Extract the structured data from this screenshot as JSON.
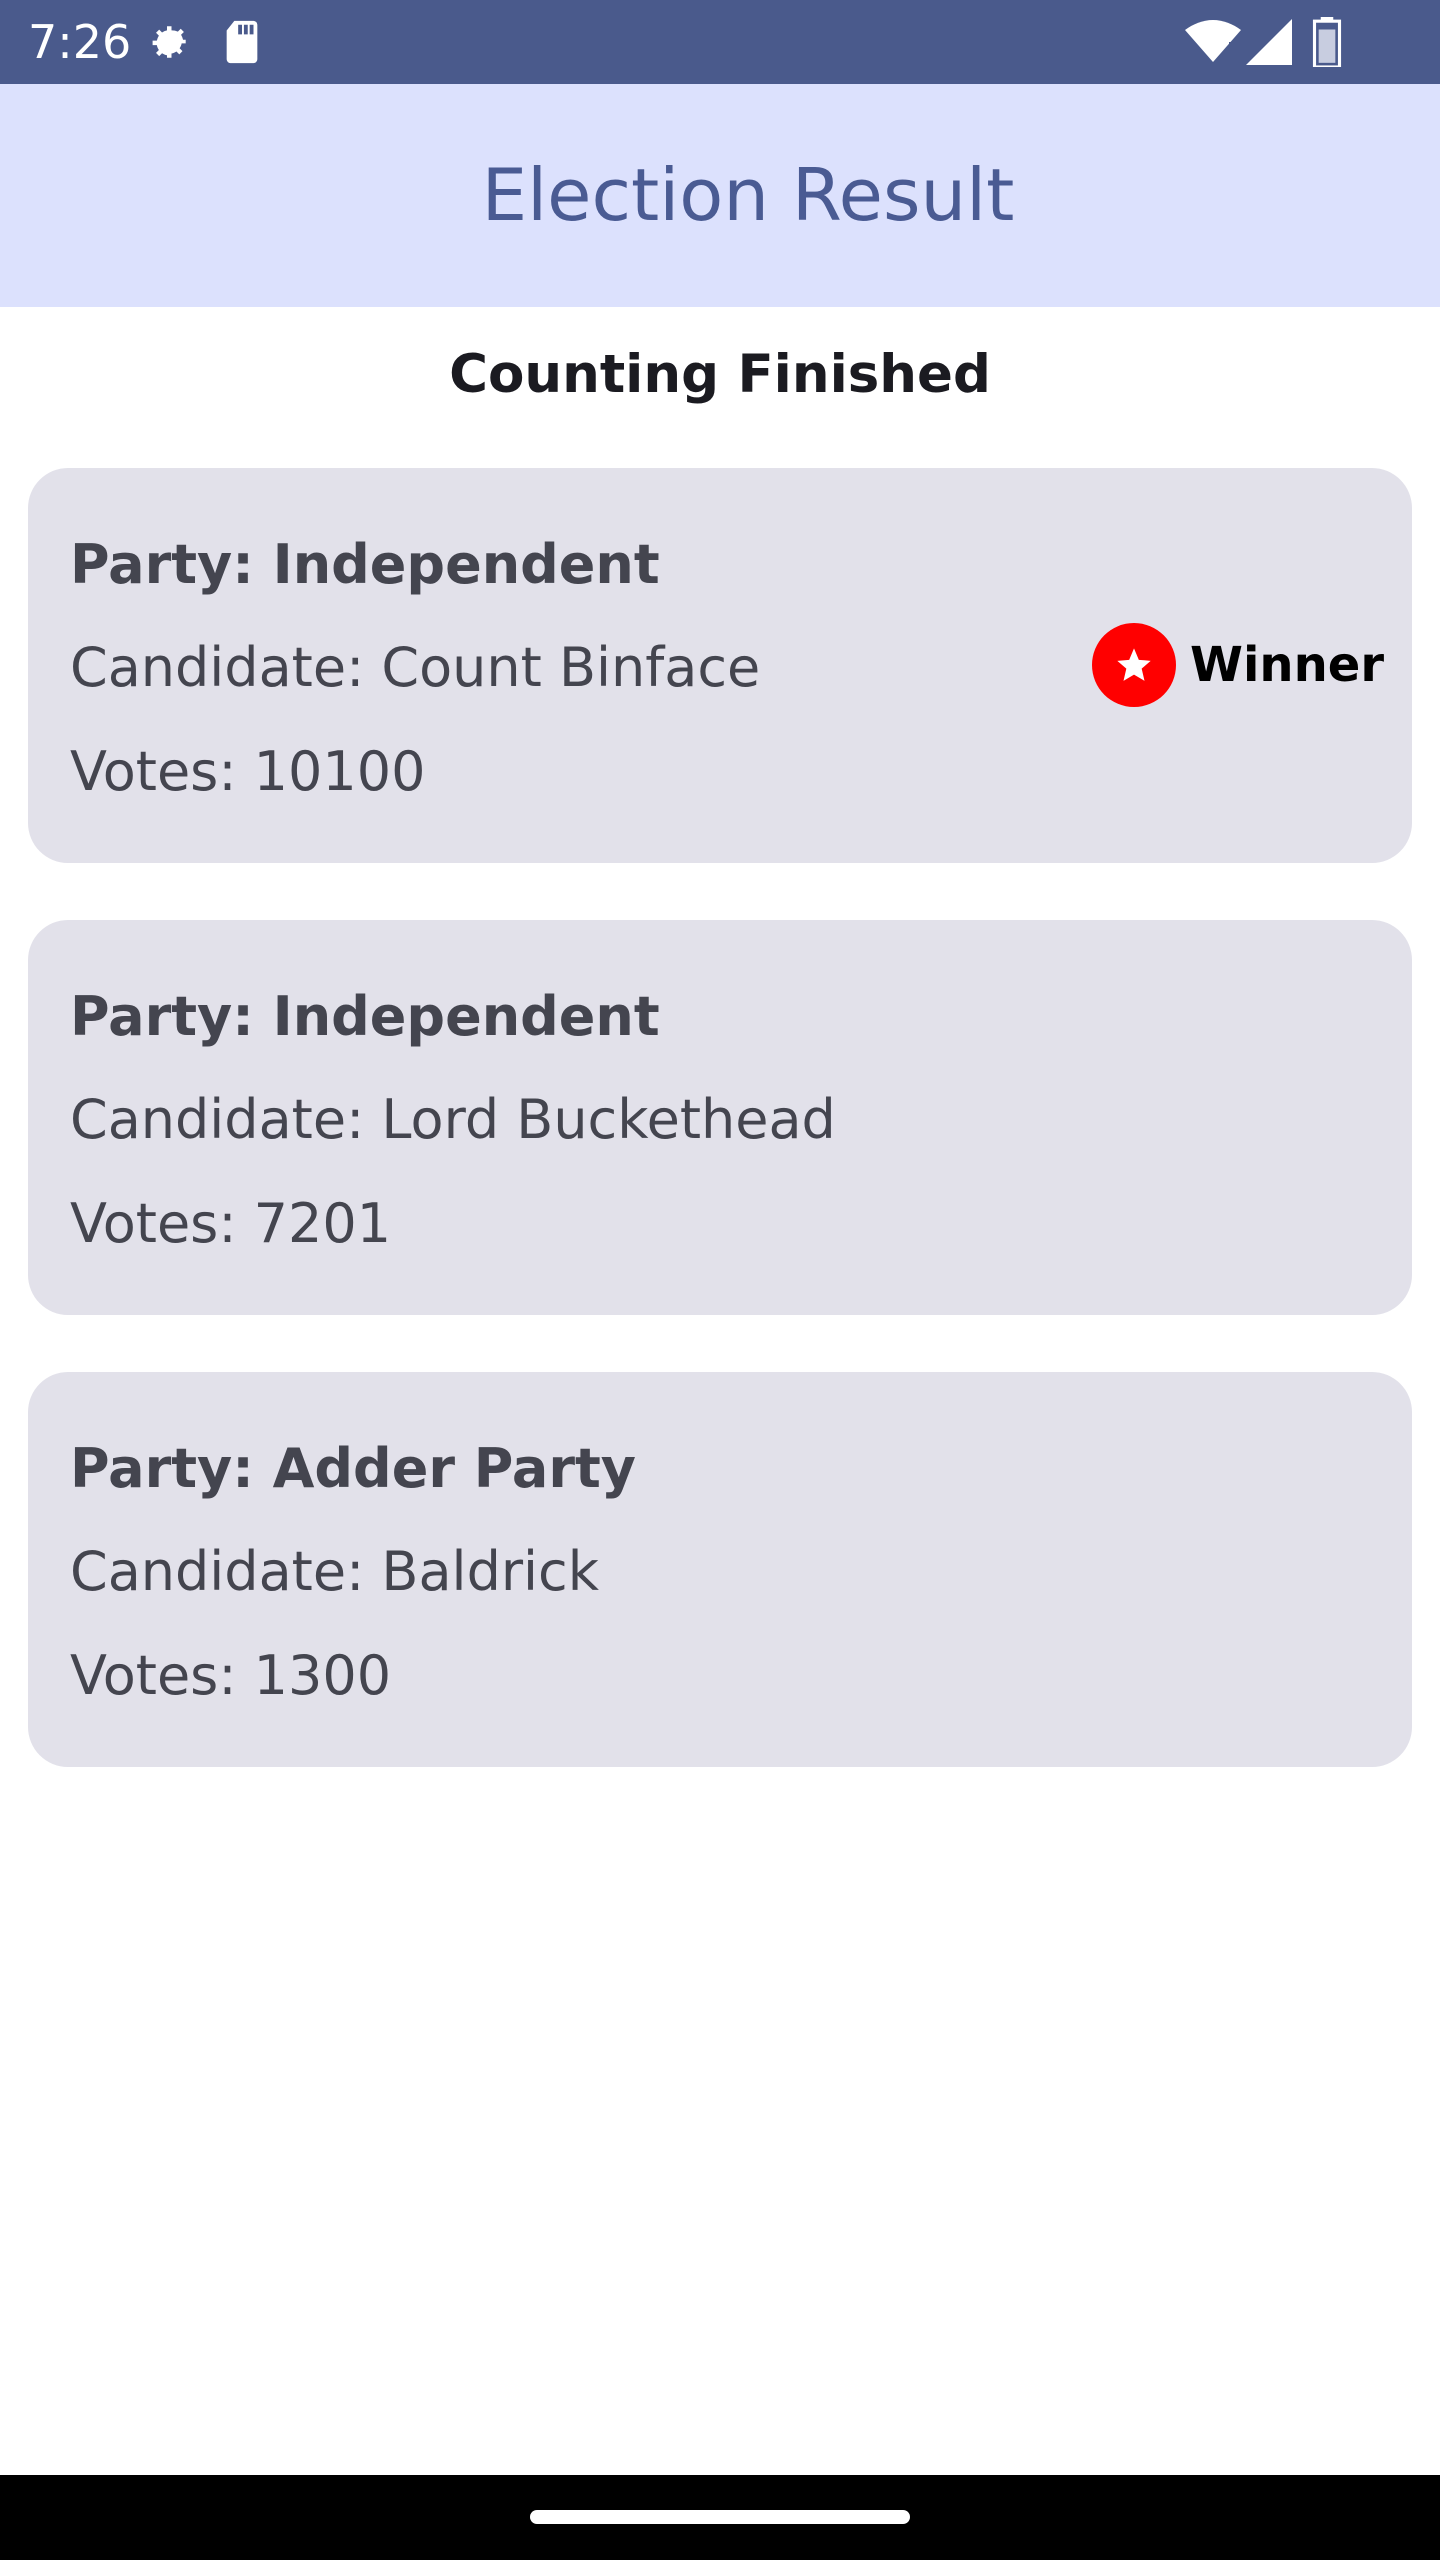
{
  "status_bar": {
    "time": "7:26",
    "icons": [
      "settings-gear-icon",
      "sd-card-icon",
      "wifi-icon",
      "cell-signal-icon",
      "battery-icon"
    ]
  },
  "app_bar": {
    "title": "Election Result"
  },
  "counting_status": "Counting Finished",
  "results": [
    {
      "party": "Party: Independent",
      "candidate": "Candidate: Count Binface",
      "votes": "Votes: 10100",
      "winner_label": "Winner"
    },
    {
      "party": "Party: Independent",
      "candidate": "Candidate: Lord Buckethead",
      "votes": "Votes: 7201"
    },
    {
      "party": "Party: Adder Party",
      "candidate": "Candidate: Baldrick",
      "votes": "Votes: 1300"
    }
  ],
  "colors": {
    "status_bar": "#4a5a8c",
    "app_bar": "#dce1fd",
    "title": "#4a5b93",
    "card": "#e2e1ea",
    "winner_badge": "#ff0000"
  }
}
